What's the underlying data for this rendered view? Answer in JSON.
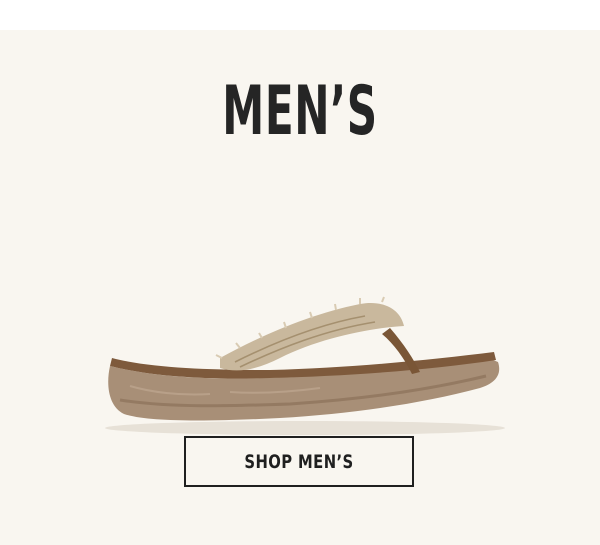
{
  "promo": {
    "title": "MEN’S",
    "product_image": {
      "description_icon": "flip-flop-sandal-image"
    },
    "cta": {
      "label": "SHOP MEN’S"
    }
  },
  "colors": {
    "background": "#f9f6f0",
    "text": "#252525",
    "sole": "#a88f77",
    "strap": "#c9b89d",
    "footbed": "#7e5a3c"
  }
}
